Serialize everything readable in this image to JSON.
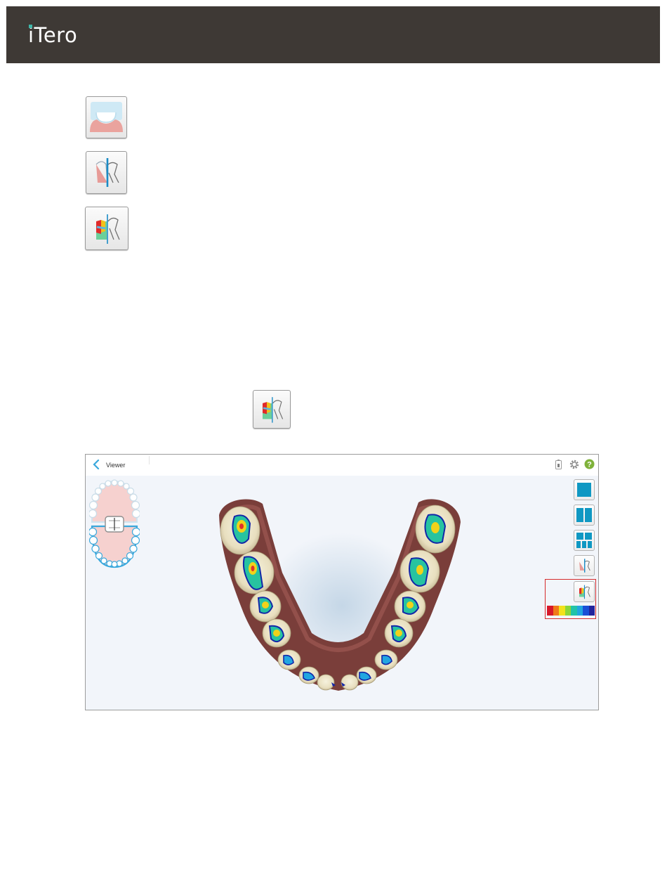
{
  "header": {
    "logo": "iTero",
    "bg_color": "#3e3935"
  },
  "tool_icons": [
    {
      "name": "bite-tool-icon"
    },
    {
      "name": "cross-section-icon"
    },
    {
      "name": "occlusogram-cross-section-icon"
    }
  ],
  "viewer": {
    "title": "Viewer",
    "back_icon": "chevron-left-icon",
    "status_icons": [
      "battery-icon",
      "gear-icon",
      "help-icon"
    ],
    "view_buttons": [
      {
        "name": "single-view-button",
        "icon": "single-pane-icon"
      },
      {
        "name": "dual-view-button",
        "icon": "dual-pane-icon"
      },
      {
        "name": "multi-view-button",
        "icon": "five-pane-icon"
      },
      {
        "name": "cross-section-button",
        "icon": "cross-section-icon"
      },
      {
        "name": "occlusogram-button",
        "icon": "occlusogram-icon"
      }
    ],
    "colors": {
      "accent": "#0f98c3",
      "help": "#7fb23a",
      "highlight": "#d62b2b"
    },
    "color_scale": [
      "#d7182a",
      "#f07a1a",
      "#f3e21a",
      "#8bd63a",
      "#22c3a8",
      "#22a6e0",
      "#1a4fd6",
      "#23249c"
    ]
  }
}
